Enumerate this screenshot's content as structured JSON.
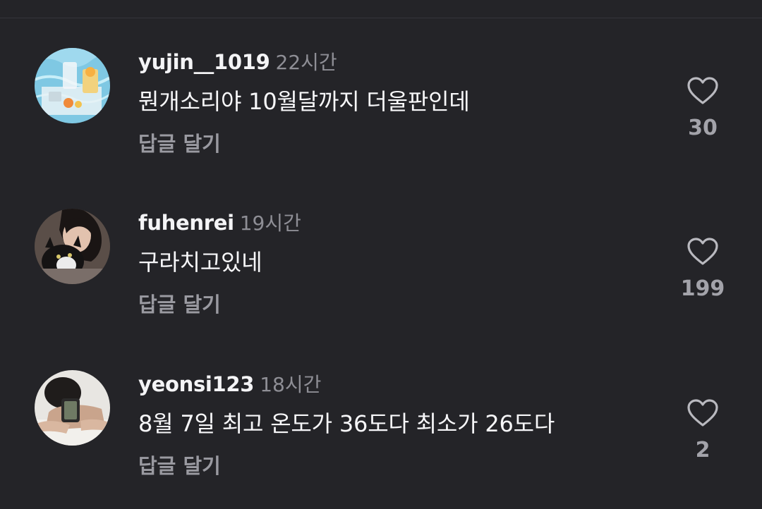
{
  "comments": [
    {
      "username": "yujin__1019",
      "time": "22시간",
      "text": "뭔개소리야 10월달까지 더울판인데",
      "reply_label": "답글 달기",
      "likes": "30",
      "avatar_icon": "pool-drinks-avatar"
    },
    {
      "username": "fuhenrei",
      "time": "19시간",
      "text": "구라치고있네",
      "reply_label": "답글 달기",
      "likes": "199",
      "avatar_icon": "girl-with-cat-avatar"
    },
    {
      "username": "yeonsi123",
      "time": "18시간",
      "text": "8월 7일 최고 온도가 36도다 최소가 26도다",
      "reply_label": "답글 달기",
      "likes": "2",
      "avatar_icon": "person-with-phone-avatar"
    }
  ],
  "icons": {
    "like": "heart-outline-icon"
  },
  "colors": {
    "background": "#242428",
    "primary_text": "#f4f4f6",
    "secondary_text": "#8e8e95",
    "reply_text": "#9a9aa1"
  }
}
